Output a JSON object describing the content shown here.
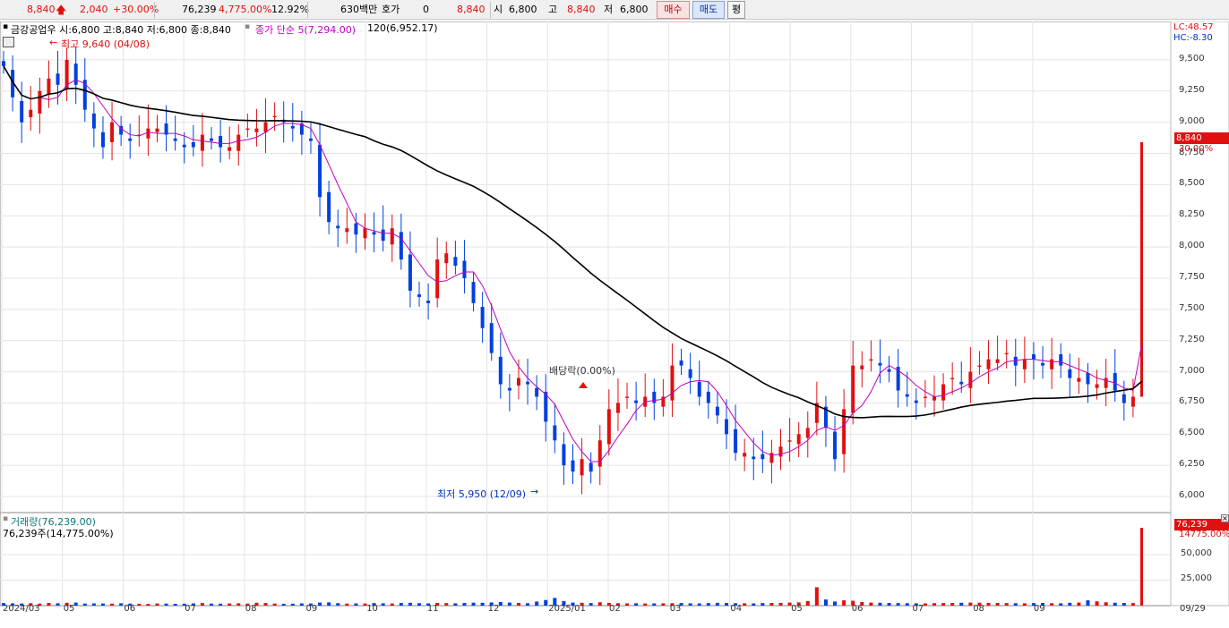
{
  "topbar": {
    "price": "8,840",
    "change": "2,040",
    "change_pct": "+30.00%",
    "volume": "76,239",
    "volume_pct": "4,775.00%",
    "turnover_pct": "12.92%",
    "amount": "630백만",
    "quote_label": "호가",
    "quote_value": "0",
    "quote_price": "8,840",
    "open_label": "시",
    "open": "6,800",
    "high_label": "고",
    "high": "8,840",
    "low_label": "저",
    "low": "6,800",
    "buy_button": "매수",
    "sell_button": "매도",
    "avg_button": "평"
  },
  "price_panel": {
    "title": "금강공업우 시:6,800 고:8,840 저:6,800 종:8,840",
    "ma_legend": "종가 단순 5(7,294.00)",
    "ma120_legend": "120(6,952.17)",
    "lc": "LC:48.57",
    "hc": "HC:-8.30",
    "high_marker": "최고 9,640 (04/08)",
    "low_marker": "최저 5,950 (12/09)",
    "dividend_marker": "배당락(0.00%)",
    "last_price_tag": "8,840",
    "last_pct_tag": "30.00%",
    "y_ticks": [
      "9,500",
      "9,250",
      "9,000",
      "8,750",
      "8,500",
      "8,250",
      "8,000",
      "7,750",
      "7,500",
      "7,250",
      "7,000",
      "6,750",
      "6,500",
      "6,250",
      "6,000"
    ]
  },
  "volume_panel": {
    "title": "거래량(76,239.00)",
    "subtitle": "76,239주(14,775.00%)",
    "last_volume_tag": "76,239",
    "last_pct_tag": "14775.00%",
    "y_ticks": [
      "50,000",
      "25,000"
    ]
  },
  "x_labels": [
    "2024/03",
    "05",
    "06",
    "07",
    "08",
    "09",
    "10",
    "11",
    "12",
    "2025/01",
    "02",
    "03",
    "04",
    "05",
    "06",
    "07",
    "08",
    "09",
    "09/29"
  ],
  "colors": {
    "up": "#e01010",
    "down": "#0040e0",
    "ma5": "#c000c0",
    "ma120": "#000000"
  },
  "chart_data": {
    "type": "candlestick",
    "y_range": [
      5900,
      9700
    ],
    "volume_range": [
      0,
      76239
    ],
    "close_series": [
      9450,
      9200,
      9000,
      9100,
      9250,
      9350,
      9300,
      9500,
      9300,
      9100,
      8950,
      8800,
      9000,
      8900,
      8850,
      8900,
      8950,
      8950,
      8900,
      8850,
      8800,
      8800,
      8900,
      8850,
      8800,
      8800,
      8900,
      8950,
      8950,
      9000,
      9050,
      9000,
      8950,
      8900,
      8850,
      8400,
      8200,
      8150,
      8150,
      8100,
      8150,
      8100,
      8050,
      8150,
      7900,
      7650,
      7600,
      7550,
      7900,
      7950,
      7850,
      7750,
      7550,
      7350,
      7150,
      6900,
      6850,
      6950,
      6900,
      6800,
      6600,
      6450,
      6250,
      6200,
      6300,
      6200,
      6450,
      6700,
      6750,
      6800,
      6750,
      6800,
      6750,
      6800,
      7050,
      7050,
      6950,
      6800,
      6750,
      6650,
      6500,
      6350,
      6350,
      6300,
      6300,
      6350,
      6400,
      6450,
      6500,
      6550,
      6750,
      6550,
      6300,
      6700,
      7050,
      7050,
      7100,
      7050,
      7000,
      6850,
      6800,
      6750,
      6800,
      6800,
      6900,
      6950,
      6900,
      7000,
      7050,
      7100,
      7100,
      7150,
      7050,
      7100,
      7100,
      7050,
      7100,
      7050,
      6950,
      6950,
      6900,
      6900,
      6950,
      6850,
      6750,
      6800,
      8840
    ],
    "volume_series": [
      2500,
      2200,
      2100,
      2400,
      2000,
      2600,
      2300,
      2800,
      3000,
      2000,
      2200,
      2100,
      1900,
      2300,
      2000,
      1800,
      1700,
      2100,
      2000,
      1800,
      1900,
      2200,
      2500,
      2000,
      1900,
      2100,
      2300,
      2000,
      2800,
      2500,
      2000,
      1800,
      1900,
      2200,
      2100,
      3000,
      3200,
      2400,
      2000,
      2200,
      2100,
      2500,
      2300,
      2100,
      2600,
      2800,
      2400,
      2200,
      2700,
      2500,
      2300,
      2600,
      2900,
      2800,
      3100,
      3500,
      3000,
      2600,
      2400,
      4000,
      5500,
      7500,
      4500,
      3000,
      2800,
      2500,
      3300,
      2600,
      2400,
      2200,
      2300,
      2100,
      2200,
      2300,
      2400,
      2600,
      2300,
      2200,
      2500,
      2700,
      2600,
      2400,
      2300,
      2200,
      2500,
      2600,
      2700,
      3000,
      3200,
      4500,
      18000,
      6000,
      4000,
      5200,
      4800,
      3500,
      3000,
      2800,
      2600,
      2500,
      2400,
      2300,
      2200,
      2400,
      2500,
      2600,
      2800,
      3000,
      2900,
      2700,
      2600,
      2500,
      2400,
      2300,
      2500,
      2600,
      2400,
      2300,
      2800,
      3000,
      5200,
      4200,
      3300,
      2800,
      2600,
      2500,
      76239
    ]
  }
}
